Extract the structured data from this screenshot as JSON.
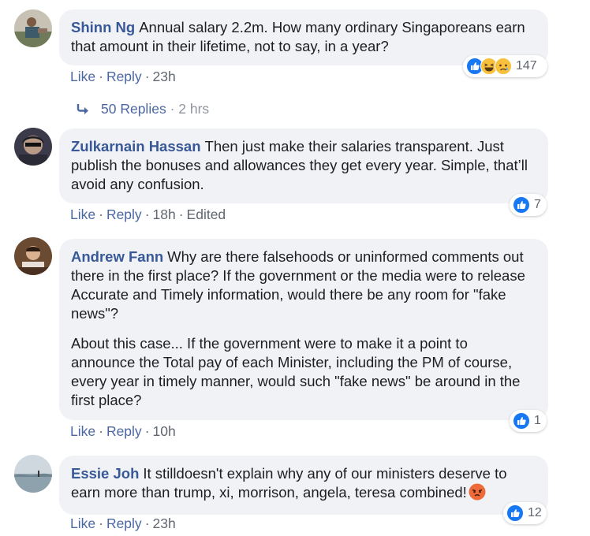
{
  "comments": [
    {
      "author": "Shinn Ng",
      "paragraphs": [
        "Annual salary 2.2m. How many ordinary Singaporeans earn that amount in their lifetime, not to say, in a year?"
      ],
      "like": "Like",
      "reply": "Reply",
      "time": "23h",
      "edited": "",
      "reactions": [
        "like",
        "haha",
        "sad"
      ],
      "reaction_count": "147"
    },
    {
      "author": "Zulkarnain Hassan",
      "paragraphs": [
        "Then just make their salaries transparent. Just publish the bonuses and allowances they get every year. Simple, that’ll avoid any confusion."
      ],
      "like": "Like",
      "reply": "Reply",
      "time": "18h",
      "edited": "Edited",
      "reactions": [
        "like"
      ],
      "reaction_count": "7"
    },
    {
      "author": "Andrew Fann",
      "paragraphs": [
        "Why are there falsehoods or uninformed comments out there in the first place? If the government or the media were to release Accurate and Timely information, would there be any room for \"fake news\"?",
        "About this case... If the government were to make it a point to announce the Total pay of each Minister, including the PM of course, every year in timely manner, would such \"fake news\" be around in the first place?"
      ],
      "like": "Like",
      "reply": "Reply",
      "time": "10h",
      "edited": "",
      "reactions": [
        "like"
      ],
      "reaction_count": "1"
    },
    {
      "author": "Essie Joh",
      "paragraphs": [
        "It stilldoesn't explain why any of our ministers deserve to earn more than trump, xi, morrison, angela, teresa combined!"
      ],
      "like": "Like",
      "reply": "Reply",
      "time": "23h",
      "edited": "",
      "reactions": [
        "like"
      ],
      "reaction_count": "12"
    }
  ],
  "replies_link": {
    "label": "50 Replies",
    "time": "2 hrs"
  },
  "colors": {
    "author": "#385898",
    "bubble": "#f0f2f5",
    "meta": "#606770",
    "like_blue": "#1877f2"
  }
}
